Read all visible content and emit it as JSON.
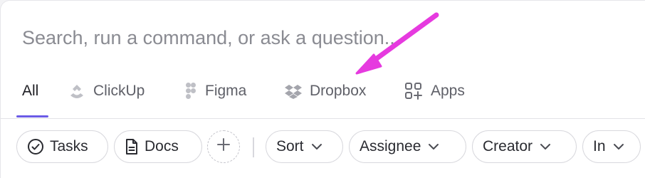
{
  "search": {
    "placeholder": "Search, run a command, or ask a question...",
    "value": ""
  },
  "tabs": [
    {
      "label": "All",
      "icon": "none",
      "active": true
    },
    {
      "label": "ClickUp",
      "icon": "clickup-logo-icon"
    },
    {
      "label": "Figma",
      "icon": "figma-logo-icon"
    },
    {
      "label": "Dropbox",
      "icon": "dropbox-logo-icon"
    },
    {
      "label": "Apps",
      "icon": "apps-grid-plus-icon"
    }
  ],
  "filters": {
    "tasks_label": "Tasks",
    "docs_label": "Docs",
    "add_label": "+",
    "sort_label": "Sort",
    "assignee_label": "Assignee",
    "creator_label": "Creator",
    "in_label": "In"
  },
  "colors": {
    "accent": "#6b5be6",
    "annotation_arrow": "#e63adf",
    "text_muted": "#5f6068",
    "placeholder": "#8a8b92"
  }
}
